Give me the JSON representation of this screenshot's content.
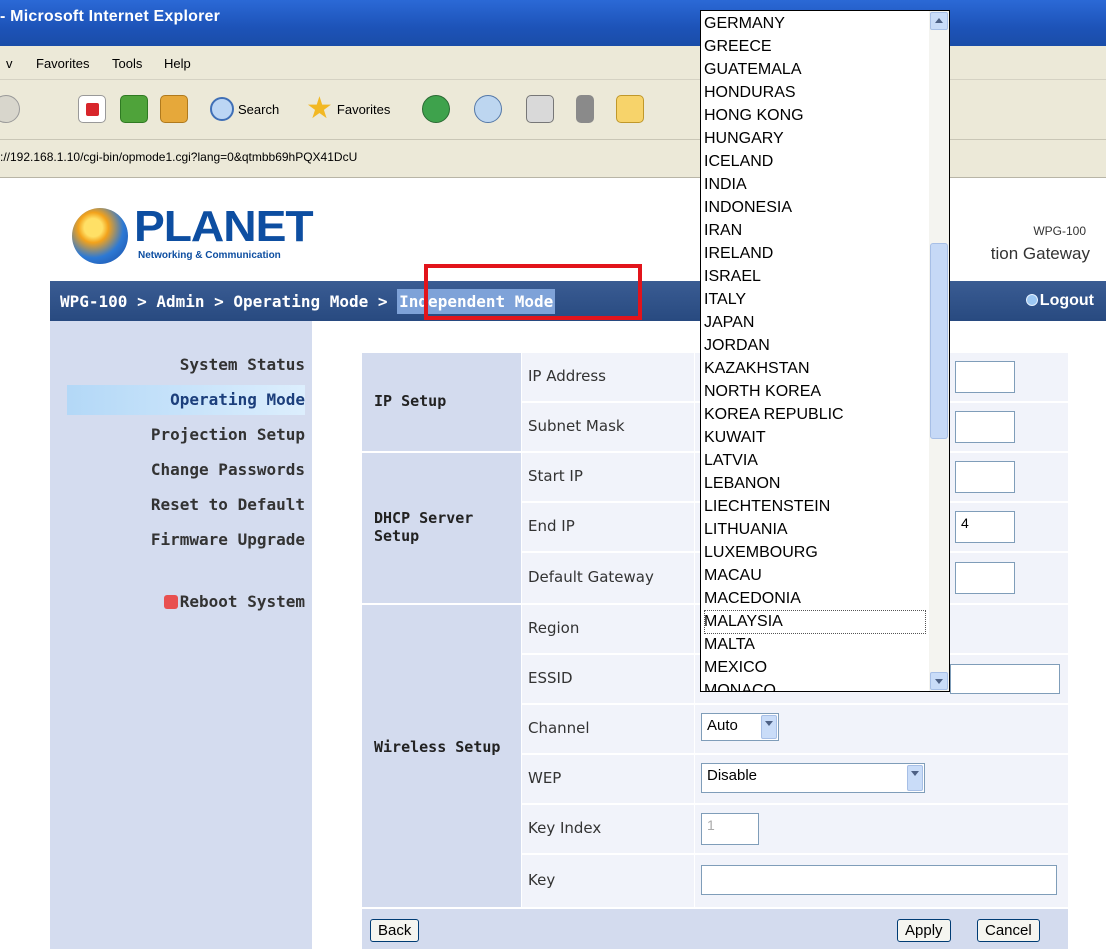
{
  "browser": {
    "title": "- Microsoft Internet Explorer",
    "menu": [
      "v",
      "Favorites",
      "Tools",
      "Help"
    ],
    "toolbar": {
      "search_label": "Search",
      "favorites_label": "Favorites"
    },
    "address": "://192.168.1.10/cgi-bin/opmode1.cgi?lang=0&qtmbb69hPQX41DcU"
  },
  "header": {
    "brand": "PLANET",
    "tagline": "Networking & Communication",
    "model": "WPG-100",
    "product": "tion Gateway"
  },
  "nav": {
    "crumbs_prefix": "WPG-100 > Admin > Operating Mode > ",
    "crumb_active": "Independent Mode",
    "logout": "Logout"
  },
  "sidebar": {
    "items": [
      {
        "label": "System Status"
      },
      {
        "label": "Operating Mode"
      },
      {
        "label": "Projection Setup"
      },
      {
        "label": "Change Passwords"
      },
      {
        "label": "Reset to Default"
      },
      {
        "label": "Firmware Upgrade"
      },
      {
        "label": "Reboot System"
      }
    ]
  },
  "form": {
    "ip_setup": {
      "title": "IP Setup",
      "ip_address_label": "IP Address",
      "subnet_mask_label": "Subnet Mask"
    },
    "dhcp": {
      "title_line1": "DHCP Server",
      "title_line2": "Setup",
      "start_ip_label": "Start IP",
      "end_ip_label": "End IP",
      "end_ip_value": "4",
      "gateway_label": "Default Gateway"
    },
    "wireless": {
      "title": "Wireless Setup",
      "region_label": "Region",
      "essid_label": "ESSID",
      "channel_label": "Channel",
      "channel_value": "Auto",
      "wep_label": "WEP",
      "wep_value": "Disable",
      "key_index_label": "Key Index",
      "key_index_value": "1",
      "key_label": "Key"
    },
    "buttons": {
      "back": "Back",
      "apply": "Apply",
      "cancel": "Cancel"
    }
  },
  "region_dropdown": {
    "options": [
      "GERMANY",
      "GREECE",
      "GUATEMALA",
      "HONDURAS",
      "HONG KONG",
      "HUNGARY",
      "ICELAND",
      "INDIA",
      "INDONESIA",
      "IRAN",
      "IRELAND",
      "ISRAEL",
      "ITALY",
      "JAPAN",
      "JORDAN",
      "KAZAKHSTAN",
      "NORTH KOREA",
      "KOREA REPUBLIC",
      "KUWAIT",
      "LATVIA",
      "LEBANON",
      "LIECHTENSTEIN",
      "LITHUANIA",
      "LUXEMBOURG",
      "MACAU",
      "MACEDONIA",
      "MALAYSIA",
      "MALTA",
      "MEXICO",
      "MONACO"
    ],
    "focused": "MALAYSIA"
  },
  "colors": {
    "nav_bg": "#2f5189",
    "sidebar_bg": "#d4dcef",
    "highlight_box": "#e2141b",
    "brand": "#0d4ea1"
  }
}
